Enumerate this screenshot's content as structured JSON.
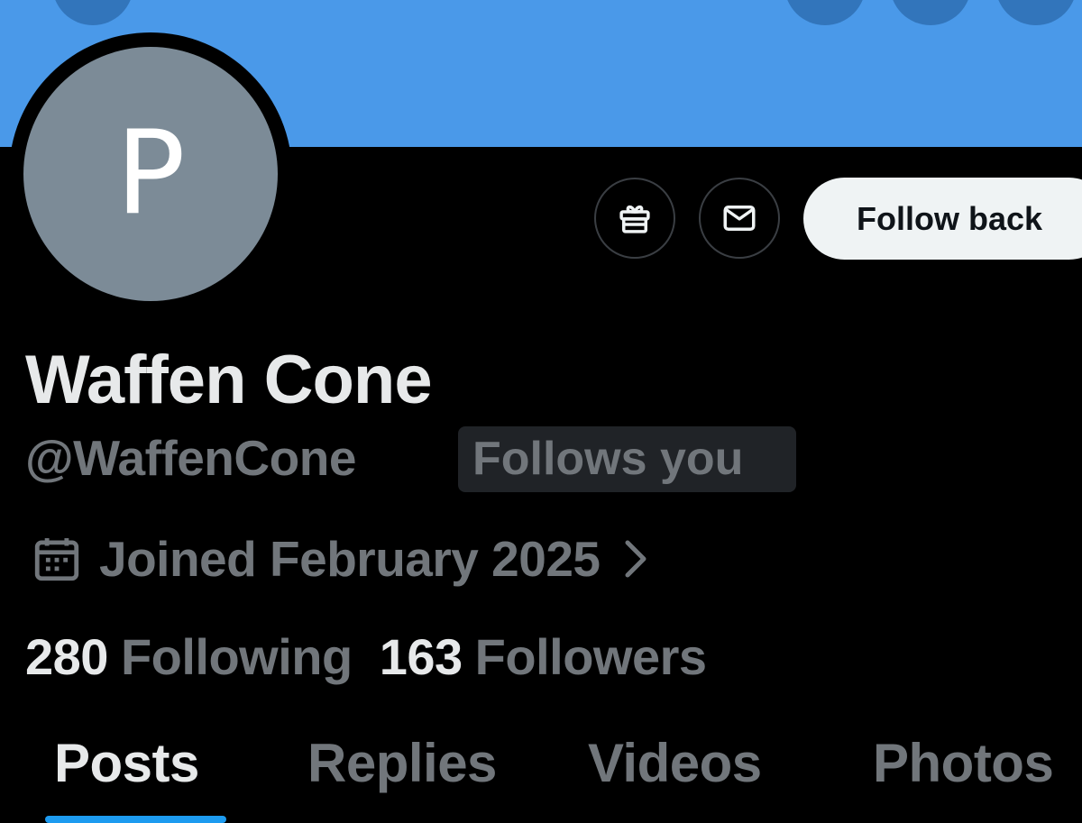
{
  "banner": {
    "color": "#4a99e9"
  },
  "profile": {
    "avatar_letter": "P",
    "avatar_color": "#7c8b97",
    "display_name": "Waffen Cone",
    "handle": "@WaffenCone",
    "follows_you_label": "Follows you",
    "joined": "Joined February 2025",
    "following_count": "280",
    "following_label": "Following",
    "followers_count": "163",
    "followers_label": "Followers"
  },
  "actions": {
    "gift_icon": "gift-icon",
    "message_icon": "envelope-icon",
    "follow_label": "Follow back"
  },
  "tabs": [
    {
      "label": "Posts",
      "active": true
    },
    {
      "label": "Replies",
      "active": false
    },
    {
      "label": "Videos",
      "active": false
    },
    {
      "label": "Photos",
      "active": false
    }
  ],
  "colors": {
    "accent": "#1d9bf0",
    "text_primary": "#e7e9ea",
    "text_secondary": "#71767b",
    "background": "#000000"
  }
}
